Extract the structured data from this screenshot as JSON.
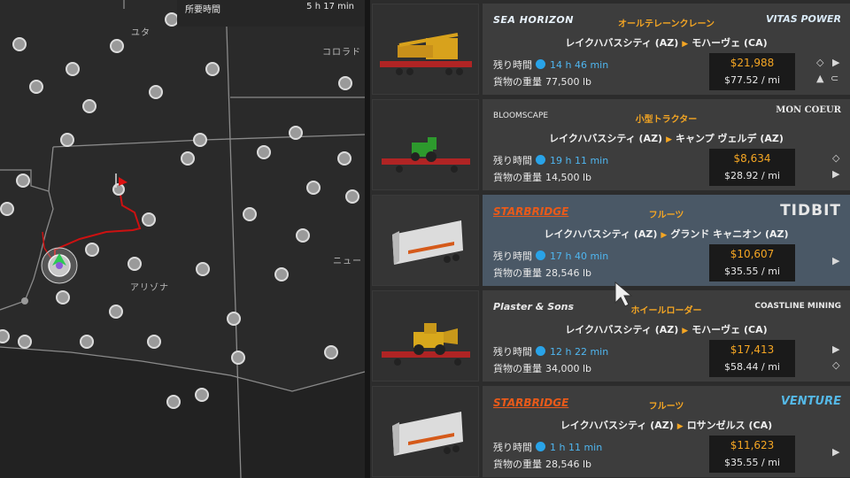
{
  "map": {
    "route_time_label": "所要時間",
    "route_time_value": "5 h 17 min",
    "labels": {
      "utah": "ユタ",
      "colorado": "コロラド",
      "arizona": "アリゾナ",
      "new": "ニュー"
    }
  },
  "labels": {
    "time_left": "残り時間",
    "cargo_weight": "貨物の重量"
  },
  "jobs": [
    {
      "company": "SEA HORIZON",
      "destination_company": "VITAS POWER",
      "cargo": "オールテレーンクレーン",
      "origin": "レイクハバスシティ (AZ)",
      "destination": "モハーヴェ (CA)",
      "time_left": "14 h 46 min",
      "weight": "77,500 lb",
      "total": "$21,988",
      "per_mile": "$77.52 / mi",
      "icons": [
        "diamond-icon",
        "arrow-right-icon",
        "weight-icon",
        "coupling-icon"
      ]
    },
    {
      "company": "BLOOMSCAPE",
      "destination_company": "MON COEUR",
      "cargo": "小型トラクター",
      "origin": "レイクハバスシティ (AZ)",
      "destination": "キャンプ ヴェルデ (AZ)",
      "time_left": "19 h 11 min",
      "weight": "14,500 lb",
      "total": "$8,634",
      "per_mile": "$28.92 / mi",
      "icons": [
        "diamond-icon",
        "arrow-right-icon"
      ]
    },
    {
      "company": "STARBRIDGE",
      "destination_company": "TIDBIT",
      "cargo": "フルーツ",
      "origin": "レイクハバスシティ (AZ)",
      "destination": "グランド キャニオン (AZ)",
      "time_left": "17 h 40 min",
      "weight": "28,546 lb",
      "total": "$10,607",
      "per_mile": "$35.55 / mi",
      "icons": [
        "arrow-right-icon"
      ]
    },
    {
      "company": "Plaster & Sons",
      "destination_company": "COASTLINE MINING",
      "cargo": "ホイールローダー",
      "origin": "レイクハバスシティ (AZ)",
      "destination": "モハーヴェ (CA)",
      "time_left": "12 h 22 min",
      "weight": "34,000 lb",
      "total": "$17,413",
      "per_mile": "$58.44 / mi",
      "icons": [
        "diamond-icon",
        "arrow-right-icon"
      ]
    },
    {
      "company": "STARBRIDGE",
      "destination_company": "VENTURE",
      "cargo": "フルーツ",
      "origin": "レイクハバスシティ (AZ)",
      "destination": "ロサンゼルス (CA)",
      "time_left": "1 h 11 min",
      "weight": "28,546 lb",
      "total": "$11,623",
      "per_mile": "$35.55 / mi",
      "icons": [
        "arrow-right-icon"
      ]
    }
  ]
}
